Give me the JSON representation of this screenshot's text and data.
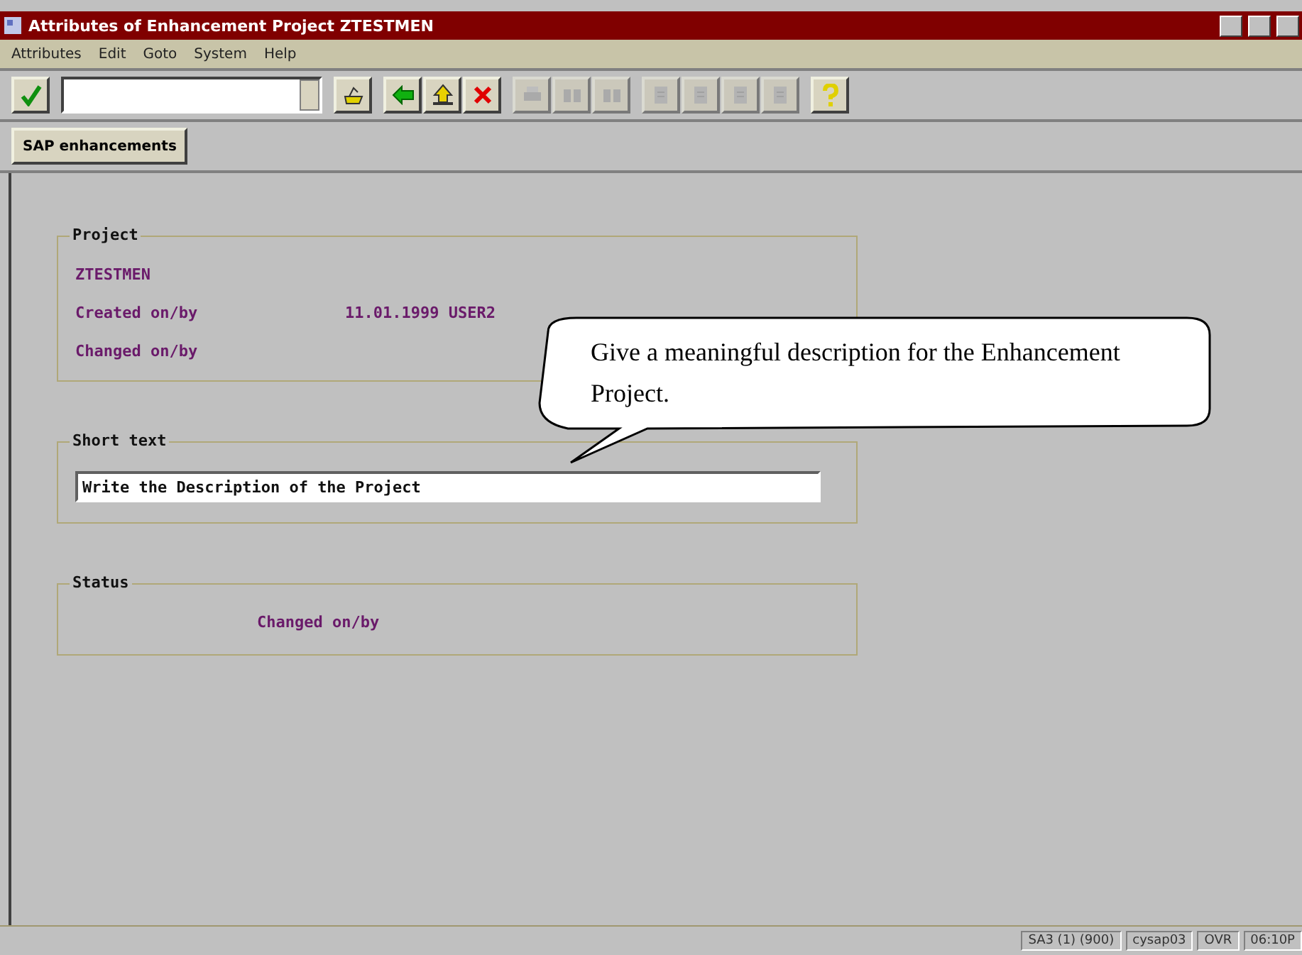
{
  "window": {
    "title": "Attributes of Enhancement Project ZTESTMEN"
  },
  "menu": [
    "Attributes",
    "Edit",
    "Goto",
    "System",
    "Help"
  ],
  "toolbar": {
    "groups": [
      [
        {
          "kind": "enter",
          "disabled": false
        }
      ],
      [
        {
          "kind": "command"
        }
      ],
      [
        {
          "kind": "save",
          "disabled": false
        }
      ],
      [
        {
          "kind": "back",
          "disabled": false
        },
        {
          "kind": "exit",
          "disabled": false
        },
        {
          "kind": "cancel",
          "disabled": false
        }
      ],
      [
        {
          "kind": "print",
          "disabled": true
        },
        {
          "kind": "find",
          "disabled": true
        },
        {
          "kind": "find-next",
          "disabled": true
        }
      ],
      [
        {
          "kind": "first",
          "disabled": true
        },
        {
          "kind": "prev",
          "disabled": true
        },
        {
          "kind": "next",
          "disabled": true
        },
        {
          "kind": "last",
          "disabled": true
        }
      ],
      [
        {
          "kind": "help",
          "disabled": false
        }
      ]
    ]
  },
  "app_toolbar": [
    "SAP enhancements"
  ],
  "project": {
    "label": "Project",
    "name": "ZTESTMEN",
    "created_label": "Created on/by",
    "created_value": "11.01.1999 USER2",
    "changed_label": "Changed on/by"
  },
  "short_text": {
    "label": "Short text",
    "value": "Write the Description of the Project"
  },
  "status": {
    "label": "Status",
    "value": "Changed on/by"
  },
  "callout": "Give a meaningful description for the Enhancement Project.",
  "status_bar": [
    "SA3 (1) (900)",
    "cysap03",
    "OVR",
    "06:10P"
  ]
}
